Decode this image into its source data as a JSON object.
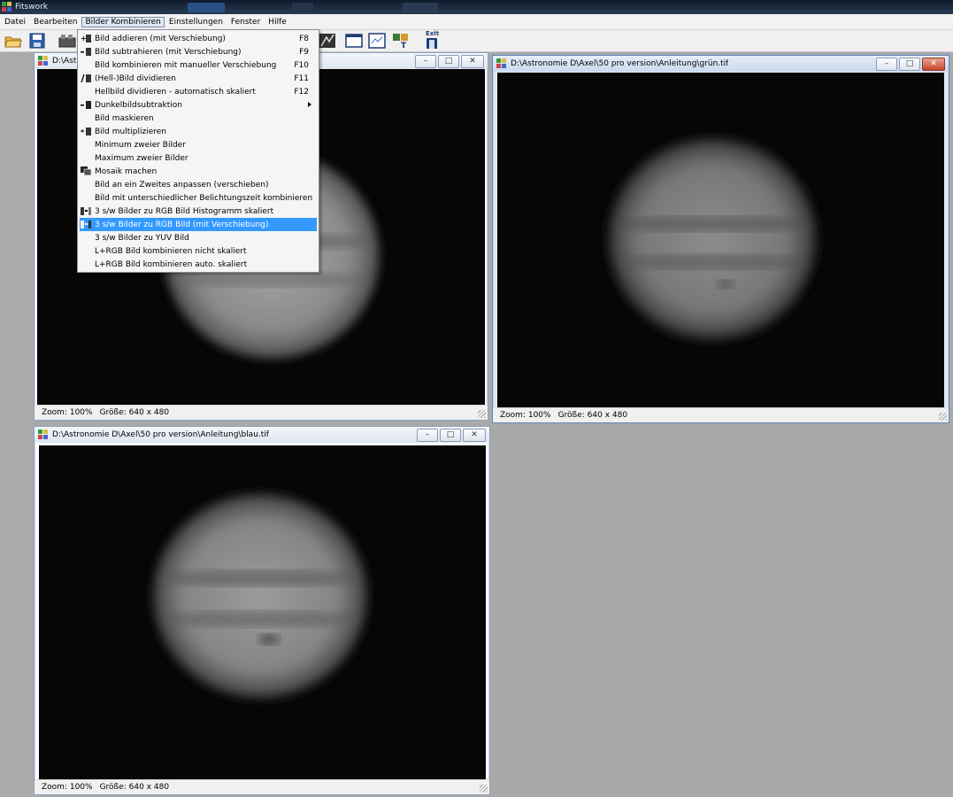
{
  "app": {
    "title": "Fitswork"
  },
  "menubar": [
    "Datei",
    "Bearbeiten",
    "Bilder Kombinieren",
    "Einstellungen",
    "Fenster",
    "Hilfe"
  ],
  "toolbar": {
    "exit_label": "Exit"
  },
  "dropdown": {
    "items": [
      {
        "label": "Bild addieren (mit Verschiebung)",
        "shortcut": "F8",
        "icon": "add-image-icon"
      },
      {
        "label": "Bild subtrahieren (mit Verschiebung)",
        "shortcut": "F9",
        "icon": "subtract-image-icon"
      },
      {
        "label": "Bild kombinieren mit manueller Verschiebung",
        "shortcut": "F10",
        "icon": ""
      },
      {
        "label": "(Hell-)Bild dividieren",
        "shortcut": "F11",
        "icon": "divide-image-icon"
      },
      {
        "label": "Hellbild dividieren - automatisch skaliert",
        "shortcut": "F12",
        "icon": ""
      },
      {
        "label": "Dunkelbildsubtraktion",
        "shortcut": "",
        "icon": "dark-frame-icon",
        "submenu": true
      },
      {
        "label": "Bild maskieren",
        "shortcut": "",
        "icon": ""
      },
      {
        "label": "Bild multiplizieren",
        "shortcut": "",
        "icon": "multiply-image-icon"
      },
      {
        "label": "Minimum zweier Bilder",
        "shortcut": "",
        "icon": ""
      },
      {
        "label": "Maximum zweier Bilder",
        "shortcut": "",
        "icon": ""
      },
      {
        "label": "Mosaik machen",
        "shortcut": "",
        "icon": "mosaic-icon"
      },
      {
        "label": "Bild an ein Zweites anpassen (verschieben)",
        "shortcut": "",
        "icon": ""
      },
      {
        "label": "Bild mit unterschiedlicher Belichtungszeit kombinieren",
        "shortcut": "",
        "icon": ""
      },
      {
        "label": "3 s/w Bilder zu RGB Bild Histogramm skaliert",
        "shortcut": "",
        "icon": "rgb-combine-icon"
      },
      {
        "label": "3 s/w Bilder zu RGB Bild (mit Verschiebung)",
        "shortcut": "",
        "icon": "rgb-combine-shift-icon",
        "highlighted": true
      },
      {
        "label": "3 s/w Bilder zu YUV Bild",
        "shortcut": "",
        "icon": ""
      },
      {
        "label": "L+RGB Bild kombinieren nicht skaliert",
        "shortcut": "",
        "icon": ""
      },
      {
        "label": "L+RGB Bild kombinieren auto. skaliert",
        "shortcut": "",
        "icon": ""
      }
    ]
  },
  "windows": [
    {
      "title": "D:\\Astro",
      "zoom": "Zoom: 100%",
      "size": "Größe: 640 x 480"
    },
    {
      "title": "D:\\Astronomie D\\Axel\\50 pro version\\Anleitung\\grün.tif",
      "zoom": "Zoom: 100%",
      "size": "Größe: 640 x 480"
    },
    {
      "title": "D:\\Astronomie D\\Axel\\50 pro version\\Anleitung\\blau.tif",
      "zoom": "Zoom: 100%",
      "size": "Größe: 640 x 480"
    }
  ],
  "colors": {
    "menu_highlight": "#3399ff",
    "canvas_bg": "#060606",
    "workspace": "#a9a9a9"
  }
}
